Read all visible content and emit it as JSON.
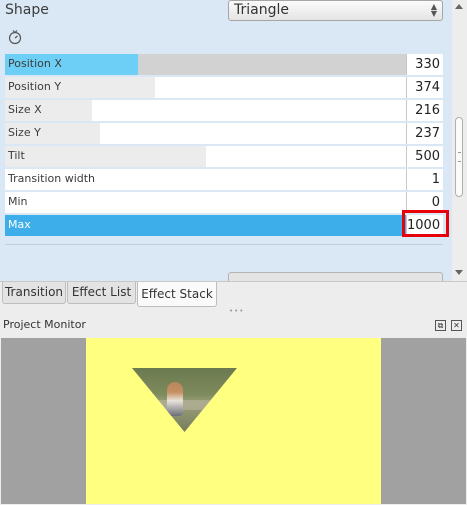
{
  "effect": {
    "shape_label": "Shape",
    "shape_value": "Triangle",
    "params": [
      {
        "label": "Position X",
        "value": "330",
        "fill": 0.33
      },
      {
        "label": "Position Y",
        "value": "374",
        "fill": 0.37
      },
      {
        "label": "Size X",
        "value": "216",
        "fill": 0.22
      },
      {
        "label": "Size Y",
        "value": "237",
        "fill": 0.24
      },
      {
        "label": "Tilt",
        "value": "500",
        "fill": 0.5
      },
      {
        "label": "Transition width",
        "value": "1",
        "fill": 0.0
      },
      {
        "label": "Min",
        "value": "0",
        "fill": 0.0
      },
      {
        "label": "Max",
        "value": "1000",
        "fill": 1.0
      }
    ]
  },
  "tabs": [
    {
      "label": "Transition"
    },
    {
      "label": "Effect List"
    },
    {
      "label": "Effect Stack"
    }
  ],
  "monitor": {
    "title": "Project Monitor",
    "float_glyph": "⧉",
    "close_glyph": "✕"
  },
  "colors": {
    "accent": "#3daee9",
    "hover_fill": "#6ecff6",
    "highlight_box": "#e8000b",
    "frame_yellow": "#ffff80"
  },
  "icons": {
    "reset": "reset-icon",
    "combo_arrows": "combo-arrows-icon"
  }
}
